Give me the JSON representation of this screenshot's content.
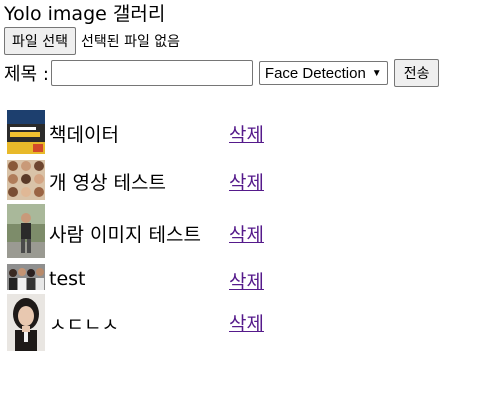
{
  "header": {
    "title": "Yolo image 갤러리"
  },
  "upload": {
    "file_button_label": "파일 선택",
    "file_status": "선택된 파일 없음",
    "title_label": "제목 :",
    "title_value": "",
    "model_selected": "Face Detection",
    "submit_label": "전송"
  },
  "gallery": {
    "items": [
      {
        "title": "책데이터",
        "delete_label": "삭제",
        "thumbnail": "book-cover-thumbnail"
      },
      {
        "title": "개 영상 테스트",
        "delete_label": "삭제",
        "thumbnail": "group-faces-thumbnail"
      },
      {
        "title": "사람 이미지 테스트",
        "delete_label": "삭제",
        "thumbnail": "person-outdoor-thumbnail"
      },
      {
        "title": "test",
        "delete_label": "삭제",
        "thumbnail": "crowd-thumbnail"
      },
      {
        "title": "ㅅㄷㄴㅅ",
        "delete_label": "삭제",
        "thumbnail": "portrait-thumbnail"
      }
    ]
  },
  "colors": {
    "visited_link": "#551a8b",
    "button_bg": "#efefef",
    "border": "#767676"
  }
}
